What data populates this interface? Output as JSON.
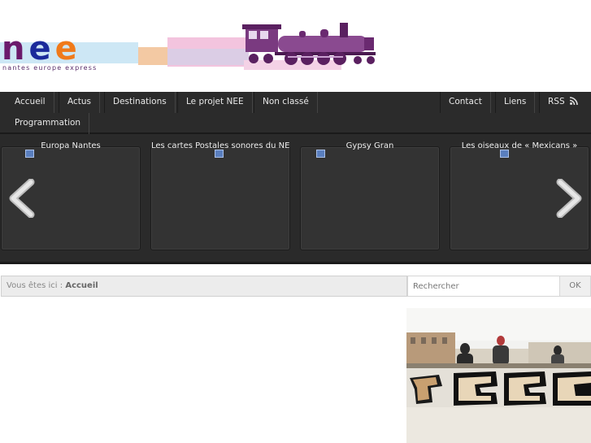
{
  "logo": {
    "name": "nee",
    "tagline": "nantes europe express",
    "colors": {
      "purple": "#6b1a6b",
      "blue": "#1a2a9b",
      "orange": "#f07a1a"
    }
  },
  "nav": {
    "left": [
      "Accueil",
      "Actus",
      "Destinations",
      "Le projet NEE",
      "Non classé"
    ],
    "right": [
      "Contact",
      "Liens",
      "RSS"
    ],
    "second_row": [
      "Programmation"
    ]
  },
  "carousel": {
    "cards": [
      {
        "title": "Europa Nantes"
      },
      {
        "title": "Les cartes Postales sonores du NEE"
      },
      {
        "title": "Gypsy Gran"
      },
      {
        "title": "Les oiseaux de « Mexicans »"
      }
    ]
  },
  "breadcrumb": {
    "prefix": "Vous êtes ici :",
    "current": "Accueil"
  },
  "search": {
    "placeholder": "Rechercher",
    "button": "OK"
  },
  "colors": {
    "nav_bg": "#2b2b2b",
    "carousel_bg": "#2a2a2a"
  }
}
